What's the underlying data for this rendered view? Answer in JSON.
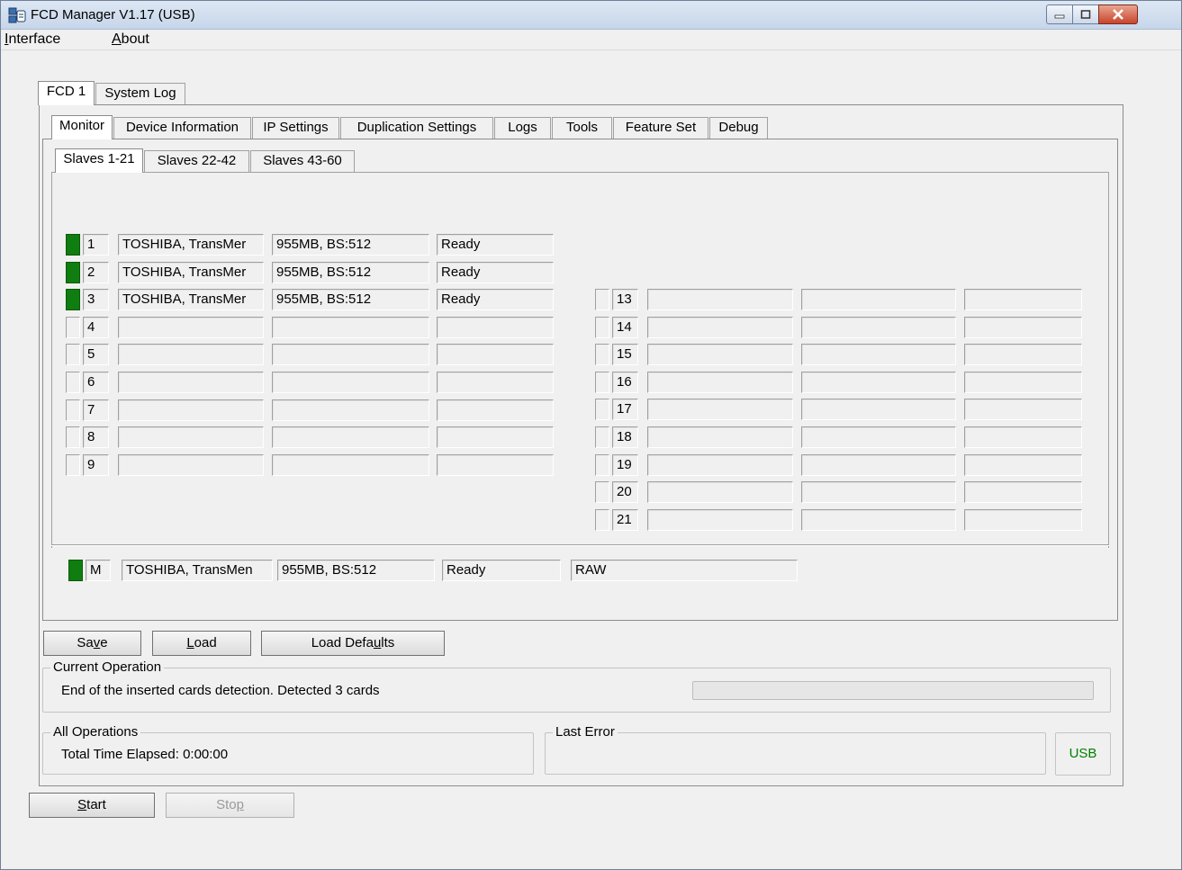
{
  "window": {
    "title": "FCD Manager V1.17 (USB)"
  },
  "menu": [
    {
      "label": "Interface",
      "mn": "I",
      "rest": "nterface"
    },
    {
      "label": "About",
      "mn": "A",
      "rest": "bout"
    }
  ],
  "outer_tabs": [
    "FCD 1",
    "System Log"
  ],
  "inner_tabs": [
    "Monitor",
    "Device Information",
    "IP Settings",
    "Duplication Settings",
    "Logs",
    "Tools",
    "Feature Set",
    "Debug"
  ],
  "slave_tabs": [
    "Slaves 1-21",
    "Slaves 22-42",
    "Slaves 43-60"
  ],
  "slaves_left": [
    {
      "num": "1",
      "active": true,
      "device": "TOSHIBA, TransMer",
      "capacity": "955MB, BS:512",
      "status": "Ready"
    },
    {
      "num": "2",
      "active": true,
      "device": "TOSHIBA, TransMer",
      "capacity": "955MB, BS:512",
      "status": "Ready"
    },
    {
      "num": "3",
      "active": true,
      "device": "TOSHIBA, TransMer",
      "capacity": "955MB, BS:512",
      "status": "Ready"
    },
    {
      "num": "4",
      "active": false,
      "device": "",
      "capacity": "",
      "status": ""
    },
    {
      "num": "5",
      "active": false,
      "device": "",
      "capacity": "",
      "status": ""
    },
    {
      "num": "6",
      "active": false,
      "device": "",
      "capacity": "",
      "status": ""
    },
    {
      "num": "7",
      "active": false,
      "device": "",
      "capacity": "",
      "status": ""
    },
    {
      "num": "8",
      "active": false,
      "device": "",
      "capacity": "",
      "status": ""
    },
    {
      "num": "9",
      "active": false,
      "device": "",
      "capacity": "",
      "status": ""
    }
  ],
  "slaves_right": [
    {
      "num": "13",
      "active": false,
      "device": "",
      "capacity": "",
      "status": ""
    },
    {
      "num": "14",
      "active": false,
      "device": "",
      "capacity": "",
      "status": ""
    },
    {
      "num": "15",
      "active": false,
      "device": "",
      "capacity": "",
      "status": ""
    },
    {
      "num": "16",
      "active": false,
      "device": "",
      "capacity": "",
      "status": ""
    },
    {
      "num": "17",
      "active": false,
      "device": "",
      "capacity": "",
      "status": ""
    },
    {
      "num": "18",
      "active": false,
      "device": "",
      "capacity": "",
      "status": ""
    },
    {
      "num": "19",
      "active": false,
      "device": "",
      "capacity": "",
      "status": ""
    },
    {
      "num": "20",
      "active": false,
      "device": "",
      "capacity": "",
      "status": ""
    },
    {
      "num": "21",
      "active": false,
      "device": "",
      "capacity": "",
      "status": ""
    }
  ],
  "master": {
    "num": "M",
    "active": true,
    "device": "TOSHIBA, TransMen",
    "capacity": "955MB, BS:512",
    "status": "Ready",
    "format": "RAW"
  },
  "buttons": {
    "save": {
      "label": "Save",
      "pre": "Sa",
      "mn": "v",
      "post": "e"
    },
    "load": {
      "label": "Load",
      "pre": "",
      "mn": "L",
      "post": "oad"
    },
    "load_defaults": {
      "label": "Load Defaults",
      "pre": "Load Defa",
      "mn": "u",
      "post": "lts"
    },
    "start": {
      "label": "Start",
      "pre": "",
      "mn": "S",
      "post": "tart"
    },
    "stop": {
      "label": "Stop",
      "pre": "Sto",
      "mn": "p",
      "post": ""
    }
  },
  "current_operation": {
    "label": "Current Operation",
    "text": "End of the inserted cards detection. Detected 3 cards"
  },
  "all_operations": {
    "label": "All Operations",
    "text": "Total Time Elapsed: 0:00:00"
  },
  "last_error": {
    "label": "Last Error",
    "text": ""
  },
  "usb_indicator": {
    "label": "USB",
    "color": "#008000"
  },
  "colors": {
    "active_indicator": "#0f7d0f",
    "title_gradient_top": "#dde7f3"
  }
}
